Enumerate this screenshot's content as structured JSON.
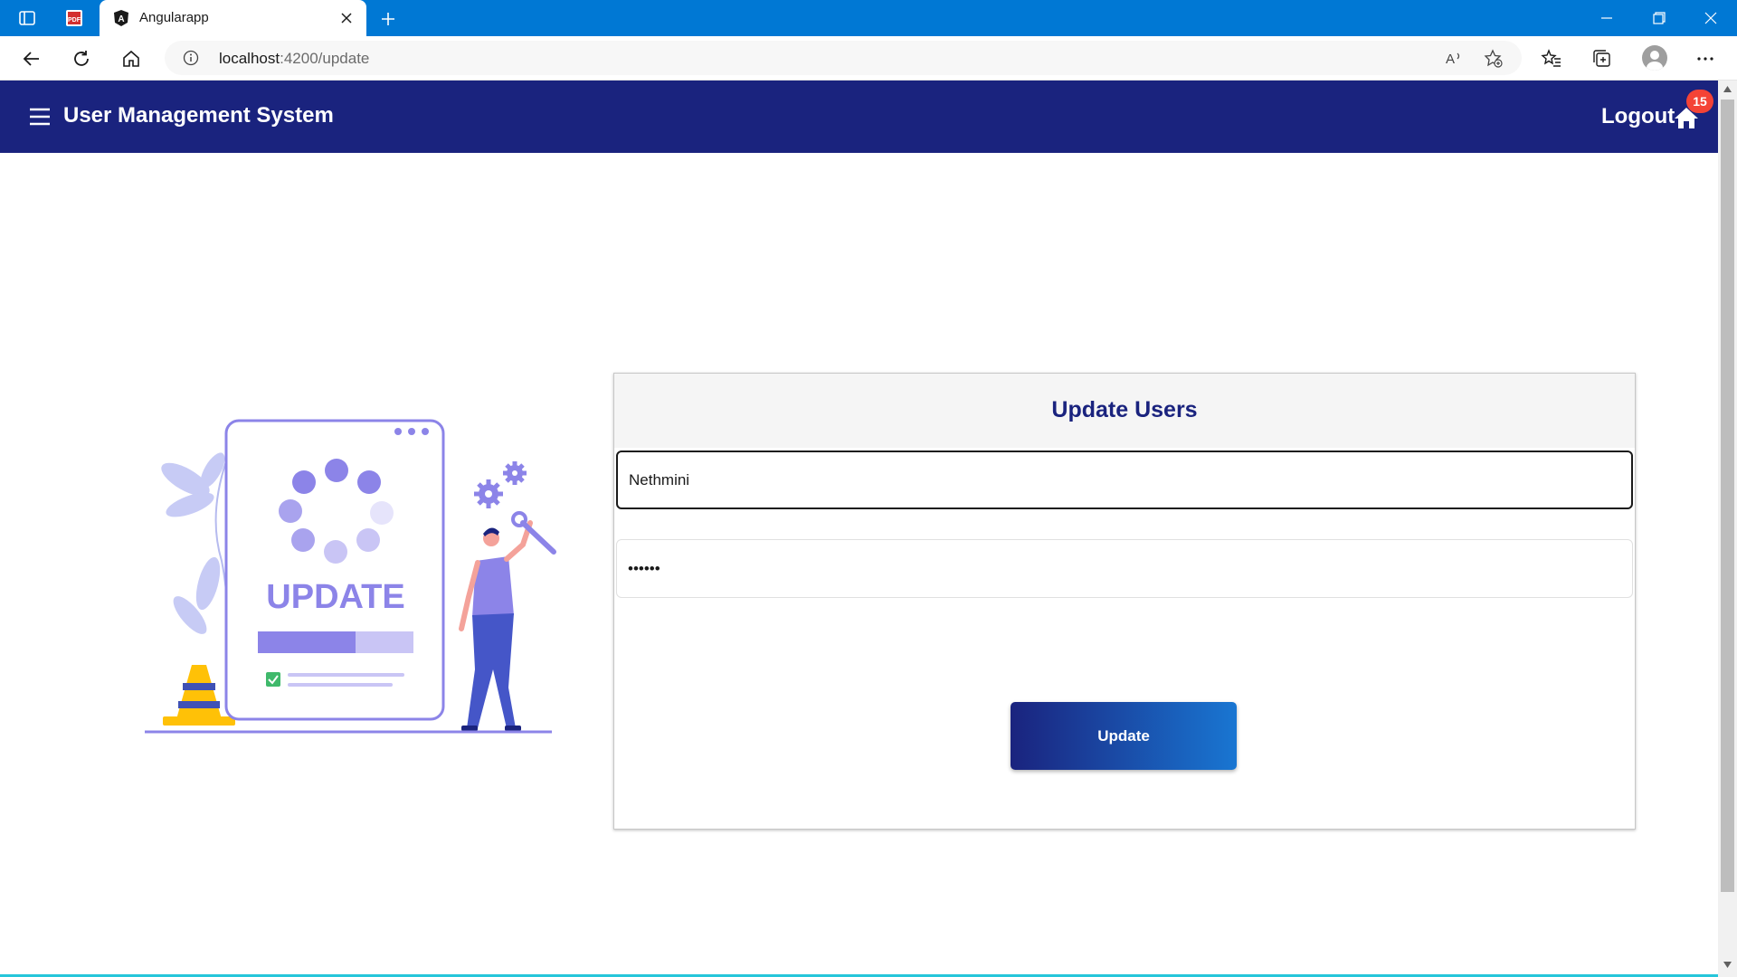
{
  "browser": {
    "tab_title": "Angularapp",
    "url_host": "localhost",
    "url_rest": ":4200/update",
    "icons": [
      "sidebar-icon",
      "pdf-icon",
      "angular-icon",
      "close-icon",
      "plus-icon",
      "minimize-icon",
      "restore-icon",
      "window-close-icon",
      "back-icon",
      "refresh-icon",
      "home-icon",
      "info-icon",
      "read-aloud-icon",
      "add-favorite-icon",
      "favorites-icon",
      "collections-icon",
      "profile-icon",
      "more-icon"
    ],
    "accent": "#0078d4"
  },
  "app": {
    "title": "User Management System",
    "logout_label": "Logout",
    "badge_count": "15",
    "header_color": "#1a237e",
    "badge_color": "#f44336"
  },
  "illustration": {
    "label": "UPDATE",
    "progress": 0.63
  },
  "form": {
    "title": "Update Users",
    "name_value": "Nethmini",
    "password_value": "••••••",
    "button_label": "Update"
  }
}
